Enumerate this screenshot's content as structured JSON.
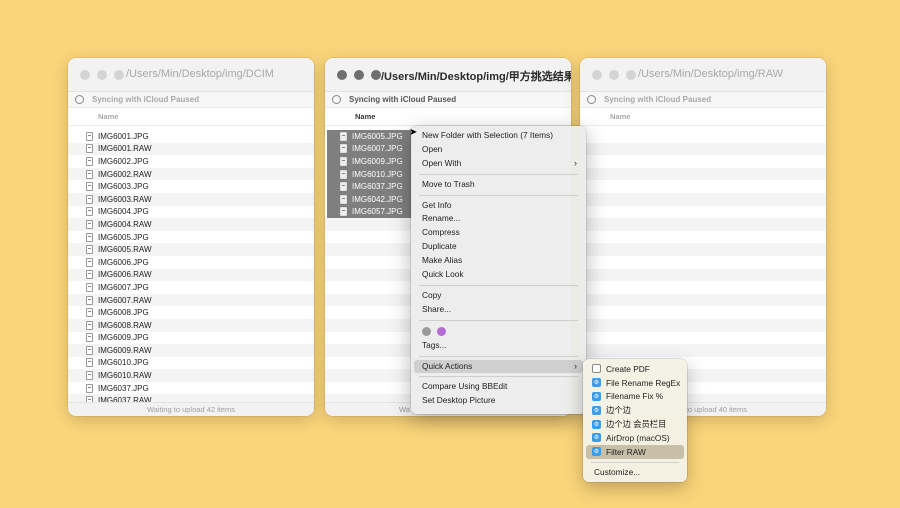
{
  "windows": [
    {
      "title": "/Users/Min/Desktop/img/DCIM",
      "sync": "Syncing with iCloud Paused",
      "column": "Name",
      "status": "Waiting to upload 42 items",
      "files": [
        "IMG6001.JPG",
        "IMG6001.RAW",
        "IMG6002.JPG",
        "IMG6002.RAW",
        "IMG6003.JPG",
        "IMG6003.RAW",
        "IMG6004.JPG",
        "IMG6004.RAW",
        "IMG6005.JPG",
        "IMG6005.RAW",
        "IMG6006.JPG",
        "IMG6006.RAW",
        "IMG6007.JPG",
        "IMG6007.RAW",
        "IMG6008.JPG",
        "IMG6008.RAW",
        "IMG6009.JPG",
        "IMG6009.RAW",
        "IMG6010.JPG",
        "IMG6010.RAW",
        "IMG6037.JPG",
        "IMG6037.RAW"
      ]
    },
    {
      "title": "/Users/Min/Desktop/img/甲方挑选结果",
      "sync": "Syncing with iCloud Paused",
      "column": "Name",
      "status": "Wa",
      "files": [
        "IMG6005.JPG",
        "IMG6007.JPG",
        "IMG6009.JPG",
        "IMG6010.JPG",
        "IMG6037.JPG",
        "IMG6042.JPG",
        "IMG6057.JPG"
      ]
    },
    {
      "title": "/Users/Min/Desktop/img/RAW",
      "sync": "Syncing with iCloud Paused",
      "column": "Name",
      "status": "Waiting to upload 40 items",
      "files": []
    }
  ],
  "context_menu": {
    "items": [
      {
        "label": "New Folder with Selection (7 Items)"
      },
      {
        "label": "Open"
      },
      {
        "label": "Open With",
        "submenu": true
      },
      {
        "sep": true
      },
      {
        "label": "Move to Trash"
      },
      {
        "sep": true
      },
      {
        "label": "Get Info"
      },
      {
        "label": "Rename..."
      },
      {
        "label": "Compress"
      },
      {
        "label": "Duplicate"
      },
      {
        "label": "Make Alias"
      },
      {
        "label": "Quick Look"
      },
      {
        "sep": true
      },
      {
        "label": "Copy"
      },
      {
        "label": "Share..."
      },
      {
        "sep": true
      },
      {
        "tags": [
          "#9a9a9a",
          "#b46bd6"
        ]
      },
      {
        "label": "Tags..."
      },
      {
        "sep": true
      },
      {
        "label": "Quick Actions",
        "submenu": true,
        "highlighted": true
      },
      {
        "sep": true
      },
      {
        "label": "Compare Using BBEdit"
      },
      {
        "label": "Set Desktop Picture"
      }
    ]
  },
  "quick_actions": {
    "items": [
      {
        "label": "Create PDF",
        "icon": "document-icon"
      },
      {
        "label": "File Rename RegEx",
        "icon": "automator-icon"
      },
      {
        "label": "Filename Fix %",
        "icon": "automator-icon"
      },
      {
        "label": "边个边",
        "icon": "automator-icon"
      },
      {
        "label": "边个边 会员栏目",
        "icon": "automator-icon"
      },
      {
        "label": "AirDrop (macOS)",
        "icon": "automator-icon"
      },
      {
        "label": "Filter RAW",
        "icon": "automator-icon",
        "highlighted": true
      },
      {
        "sep": true
      },
      {
        "label": "Customize..."
      }
    ]
  },
  "colors": {
    "background": "#fbd57a",
    "selection": "#7f7f7f",
    "highlight": "#cfcfcf"
  }
}
